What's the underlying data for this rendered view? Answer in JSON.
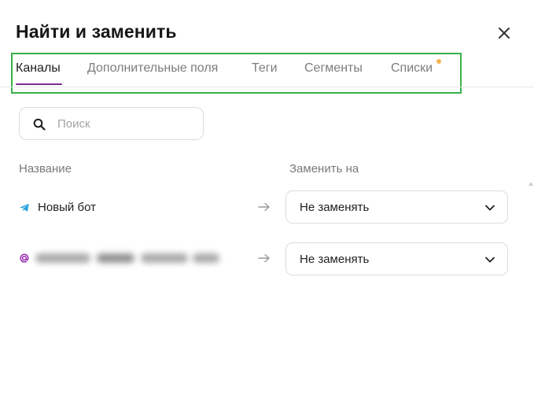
{
  "dialog": {
    "title": "Найти и заменить"
  },
  "tabs": [
    {
      "label": "Каналы",
      "active": true
    },
    {
      "label": "Дополнительные поля",
      "active": false
    },
    {
      "label": "Теги",
      "active": false
    },
    {
      "label": "Сегменты",
      "active": false
    },
    {
      "label": "Списки",
      "active": false,
      "indicator": true
    }
  ],
  "search": {
    "placeholder": "Поиск",
    "value": ""
  },
  "columns": {
    "name": "Название",
    "replace": "Заменить на"
  },
  "rows": [
    {
      "icon": "telegram-icon",
      "name": "Новый бот",
      "select": "Не заменять"
    },
    {
      "icon": "at-sign-icon",
      "name": "",
      "name_obscured": true,
      "select": "Не заменять"
    }
  ],
  "colors": {
    "accent": "#7b2d91",
    "highlight_box": "#3ab04a",
    "tab_indicator_dot": "#f4b552",
    "telegram": "#2aa3db",
    "at_sign": "#9b2ab0"
  }
}
